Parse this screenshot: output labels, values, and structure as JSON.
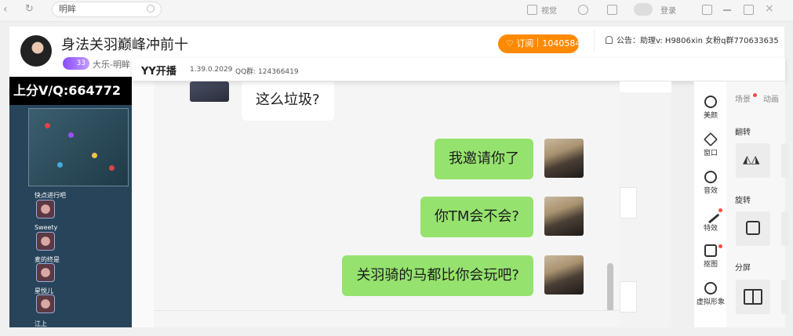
{
  "browser": {
    "search_text": "明眸",
    "top_right_label_1": "视觉",
    "top_right_label_2": "登录"
  },
  "room": {
    "title": "身法关羽巅峰冲前十",
    "level": "33",
    "owner": "大乐-明眸",
    "subscribe_label": "订阅",
    "subscribe_count": "1040584",
    "notice": "公告：助理v: H9806xin 女粉q群770633635"
  },
  "video": {
    "banner": "上分V/Q:664772",
    "players": [
      {
        "name": "快点进行吧"
      },
      {
        "name": "Sweety"
      },
      {
        "name": "麦的终是"
      },
      {
        "name": "星悦儿"
      },
      {
        "name": "江上"
      }
    ]
  },
  "yy": {
    "title": "YY开播",
    "version": "1.39.0.2029",
    "qq_group": "QQ群: 124366419"
  },
  "chat": {
    "messages": [
      {
        "side": "left",
        "text": "这么垃圾?"
      },
      {
        "side": "right",
        "text": "我邀请你了"
      },
      {
        "side": "right",
        "text": "你TM会不会?"
      },
      {
        "side": "right",
        "text": "关羽骑的马都比你会玩吧?"
      }
    ]
  },
  "tools": {
    "items": [
      {
        "label": "美颜",
        "icon": "beauty-icon"
      },
      {
        "label": "窗口",
        "icon": "layers-icon"
      },
      {
        "label": "音效",
        "icon": "sound-icon"
      },
      {
        "label": "特效",
        "icon": "magic-wand-icon"
      },
      {
        "label": "抠图",
        "icon": "cutout-icon"
      },
      {
        "label": "虚拟形象",
        "icon": "avatar-bear-icon"
      }
    ]
  },
  "options": {
    "tab_scene": "场景",
    "tab_anim": "动画",
    "section_flip": "翻转",
    "section_rotate": "旋转",
    "section_split": "分屏"
  },
  "colors": {
    "accent_orange": "#ff8a00",
    "bubble_green": "#95e36e",
    "badge_purple": "#8a4dff"
  }
}
